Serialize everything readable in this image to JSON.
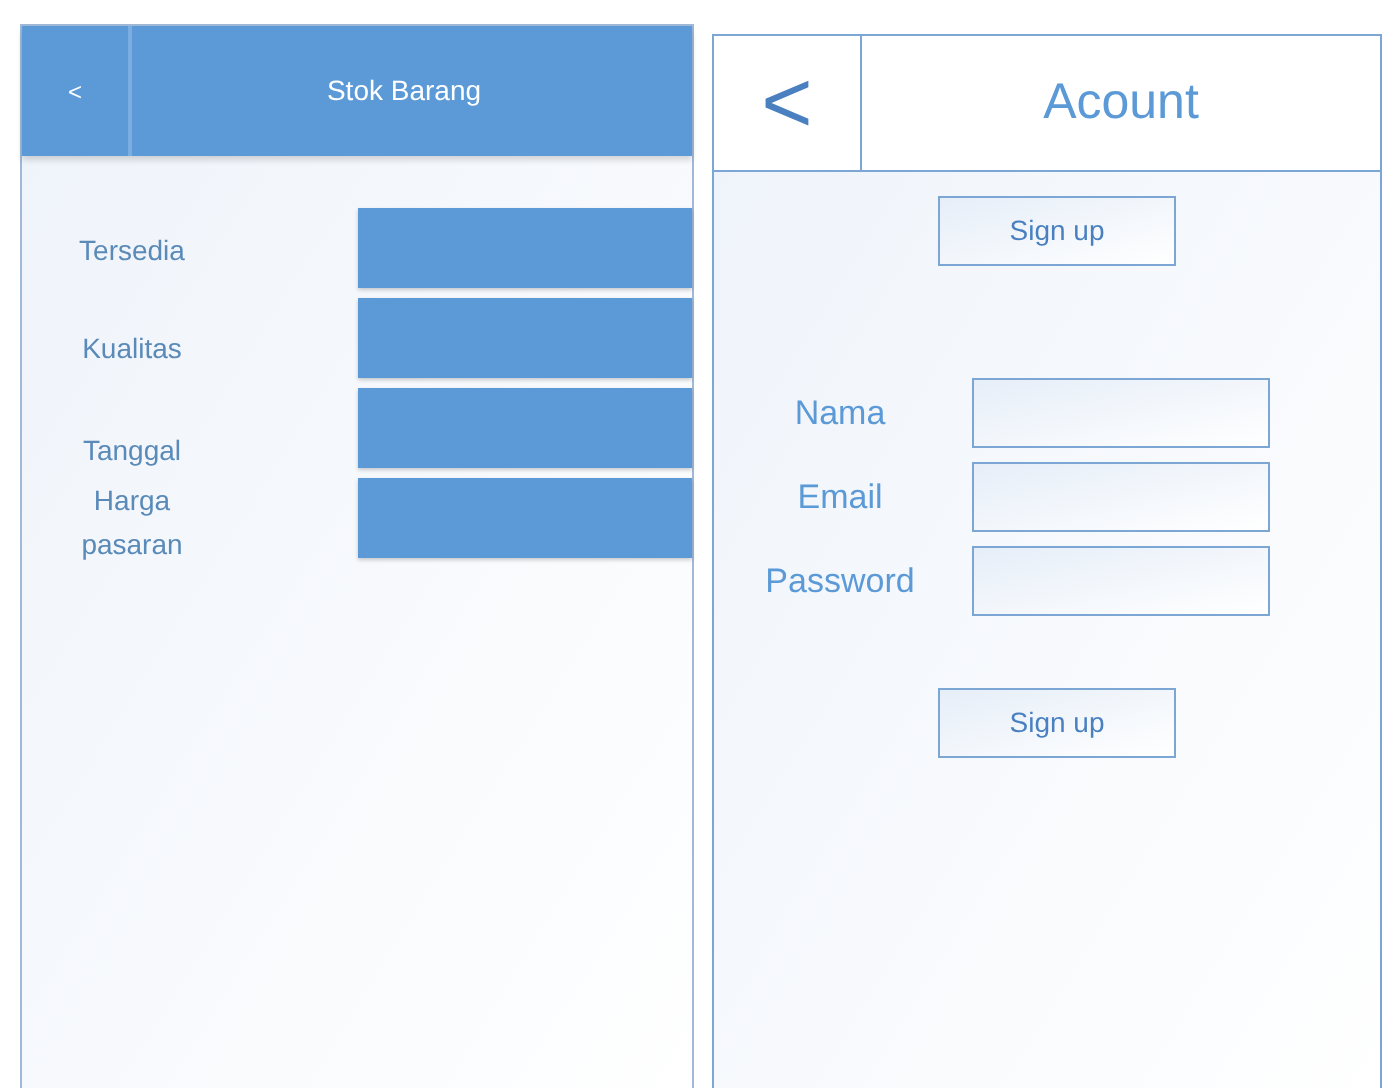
{
  "stock_screen": {
    "back": "<",
    "title": "Stok Barang",
    "fields": [
      {
        "label": "Tersedia"
      },
      {
        "label": "Kualitas"
      },
      {
        "label": "Tanggal"
      },
      {
        "label": "Harga pasaran"
      }
    ]
  },
  "account_screen": {
    "back": "<",
    "title": "Acount",
    "top_button": "Sign up",
    "fields": [
      {
        "label": "Nama"
      },
      {
        "label": "Email"
      },
      {
        "label": "Password"
      }
    ],
    "bottom_button": "Sign up"
  }
}
